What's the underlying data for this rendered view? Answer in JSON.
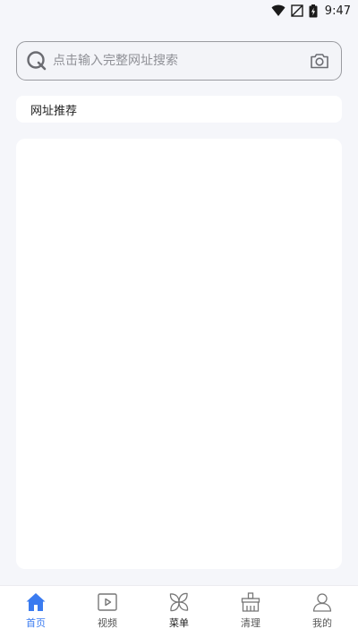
{
  "status_bar": {
    "time": "9:47",
    "icons": [
      "wifi-icon",
      "no-signal-icon",
      "battery-charging-icon"
    ]
  },
  "search": {
    "placeholder": "点击输入完整网址搜索",
    "value": "",
    "left_icon": "search-icon",
    "right_icon": "camera-icon"
  },
  "recommend": {
    "label": "网址推荐"
  },
  "bottom_nav": {
    "active_color": "#3a7bf0",
    "items": [
      {
        "label": "首页",
        "icon": "home-icon"
      },
      {
        "label": "视频",
        "icon": "video-icon"
      },
      {
        "label": "菜单",
        "icon": "menu-flower-icon"
      },
      {
        "label": "清理",
        "icon": "broom-icon"
      },
      {
        "label": "我的",
        "icon": "person-icon"
      }
    ]
  }
}
